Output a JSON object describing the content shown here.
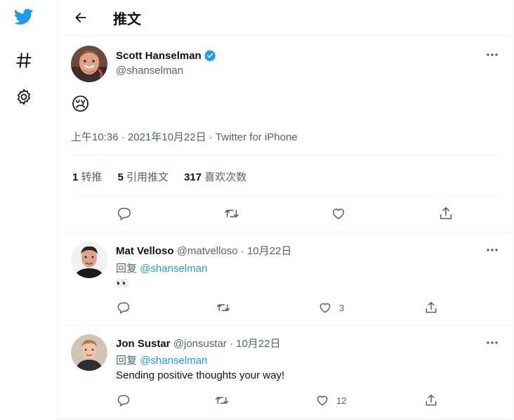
{
  "page_title": "推文",
  "tweet": {
    "author_name": "Scott Hanselman",
    "handle": "@shanselman",
    "content_emoji": "😢",
    "timestamp": "上午10:36 · 2021年10月22日 · Twitter for iPhone",
    "stats": {
      "retweets_count": "1",
      "retweets_label": "转推",
      "quotes_count": "5",
      "quotes_label": "引用推文",
      "likes_count": "317",
      "likes_label": "喜欢次数"
    }
  },
  "replies": [
    {
      "name": "Mat Velloso",
      "handle_date": "@matvelloso · 10月22日",
      "reply_prefix": "回复",
      "reply_to": "@shanselman",
      "text": "👀",
      "likes": "3"
    },
    {
      "name": "Jon Sustar",
      "handle_date": "@jonsustar · 10月22日",
      "reply_prefix": "回复",
      "reply_to": "@shanselman",
      "text": "Sending positive thoughts your way!",
      "likes": "12"
    }
  ],
  "colors": {
    "accent": "#1d9bf0",
    "text": "#0f1419",
    "muted": "#536471",
    "border": "#eff3f4"
  }
}
